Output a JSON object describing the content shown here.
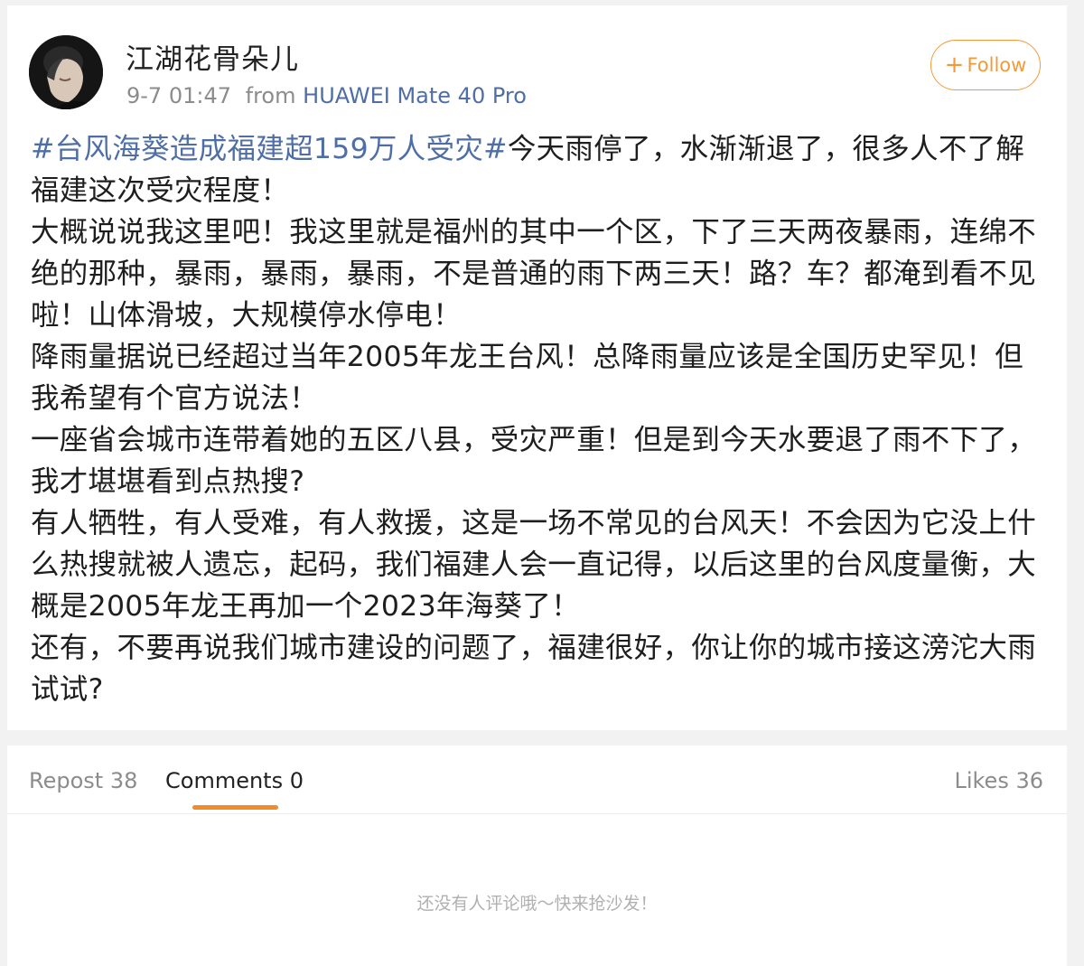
{
  "post": {
    "username": "江湖花骨朵儿",
    "time": "9-7 01:47",
    "from_label": "from",
    "device": "HUAWEI Mate 40 Pro",
    "follow_label": "Follow",
    "follow_icon": "plus-icon",
    "avatar_icon": "user-avatar-photo",
    "hashtag": "#台风海葵造成福建超159万人受灾#",
    "first_line_rest": "今天雨停了，水渐渐退了，很多人不了解福建这次受灾程度！",
    "paragraphs": [
      "大概说说我这里吧！我这里就是福州的其中一个区，下了三天两夜暴雨，连绵不绝的那种，暴雨，暴雨，暴雨，不是普通的雨下两三天！路？车？都淹到看不见啦！山体滑坡，大规模停水停电！",
      "降雨量据说已经超过当年2005年龙王台风！总降雨量应该是全国历史罕见！但我希望有个官方说法！",
      "一座省会城市连带着她的五区八县，受灾严重！但是到今天水要退了雨不下了，我才堪堪看到点热搜?",
      "有人牺牲，有人受难，有人救援，这是一场不常见的台风天！不会因为它没上什么热搜就被人遗忘，起码，我们福建人会一直记得，以后这里的台风度量衡，大概是2005年龙王再加一个2023年海葵了！",
      "还有，不要再说我们城市建设的问题了，福建很好，你让你的城市接这滂沱大雨试试?"
    ]
  },
  "tabs": {
    "repost": "Repost 38",
    "comments": "Comments 0",
    "likes": "Likes 36"
  },
  "comments": {
    "empty_message": "还没有人评论哦～快来抢沙发！"
  },
  "colors": {
    "accent_orange": "#f29a3a",
    "link_blue": "#4e6ea5",
    "text": "#1e1e1e",
    "muted": "#8c8c8c"
  }
}
